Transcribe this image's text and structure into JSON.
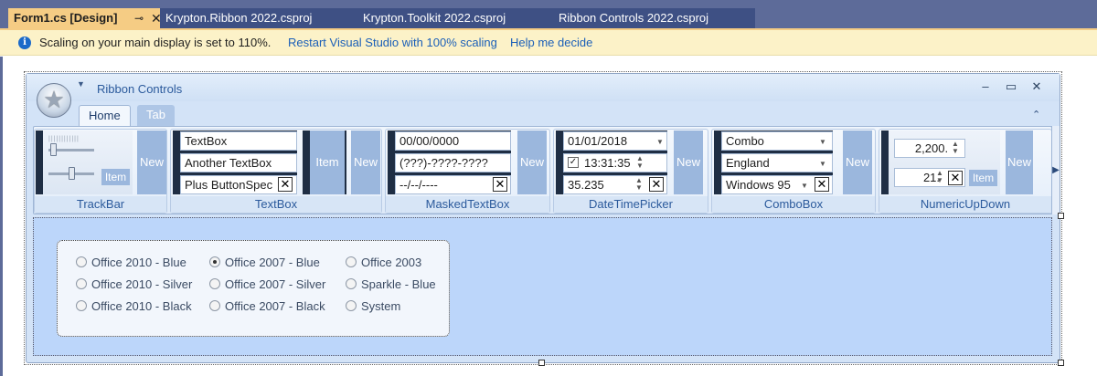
{
  "doc_tabs": [
    {
      "label": "Form1.cs [Design]",
      "active": true
    },
    {
      "label": "Krypton.Ribbon 2022.csproj"
    },
    {
      "label": "Krypton.Toolkit 2022.csproj"
    },
    {
      "label": "Ribbon Controls 2022.csproj"
    }
  ],
  "infobar": {
    "message": "Scaling on your main display is set to 110%.",
    "link_restart": "Restart Visual Studio with 100% scaling",
    "link_help": "Help me decide"
  },
  "form": {
    "title": "Ribbon Controls",
    "tabs": [
      "Home",
      "Tab"
    ]
  },
  "groups": {
    "trackbar": {
      "label": "TrackBar",
      "item": "Item",
      "new": "New"
    },
    "textbox": {
      "label": "TextBox",
      "field1": "TextBox",
      "field2": "Another TextBox",
      "field3": "Plus ButtonSpec",
      "item": "Item",
      "new": "New"
    },
    "masked": {
      "label": "MaskedTextBox",
      "field1": "00/00/0000",
      "field2": "(???)-????-????",
      "field3": "--/--/----",
      "new": "New"
    },
    "datetime": {
      "label": "DateTimePicker",
      "date": "01/01/2018",
      "time": "13:31:35",
      "number": "35.235",
      "new": "New"
    },
    "combo": {
      "label": "ComboBox",
      "field1": "Combo",
      "field2": "England",
      "field3": "Windows 95",
      "new": "New"
    },
    "numeric": {
      "label": "NumericUpDown",
      "value1": "2,200.",
      "value2": "21.",
      "item": "Item",
      "new": "New"
    }
  },
  "palette": {
    "col1": [
      "Office 2010 - Blue",
      "Office 2010 - Silver",
      "Office 2010 - Black"
    ],
    "col2": [
      "Office 2007 - Blue",
      "Office 2007 - Silver",
      "Office 2007 - Black"
    ],
    "col3": [
      "Office 2003",
      "Sparkle - Blue",
      "System"
    ],
    "selected": "Office 2007 - Blue"
  },
  "colors": {
    "accent": "#f5cc84",
    "tabbar": "#5d6b99",
    "link": "#1b5fb8",
    "ribbon_label": "#2b5a9c",
    "client_bg": "#bcd6fa"
  },
  "icons": [
    "pin-icon",
    "close-icon",
    "info-icon",
    "orb-star-icon",
    "minimize-icon",
    "maximize-icon",
    "window-close-icon",
    "collapse-ribbon-icon",
    "dropdown-arrow-icon",
    "spin-arrows-icon",
    "clear-x-icon",
    "scroll-right-icon"
  ]
}
